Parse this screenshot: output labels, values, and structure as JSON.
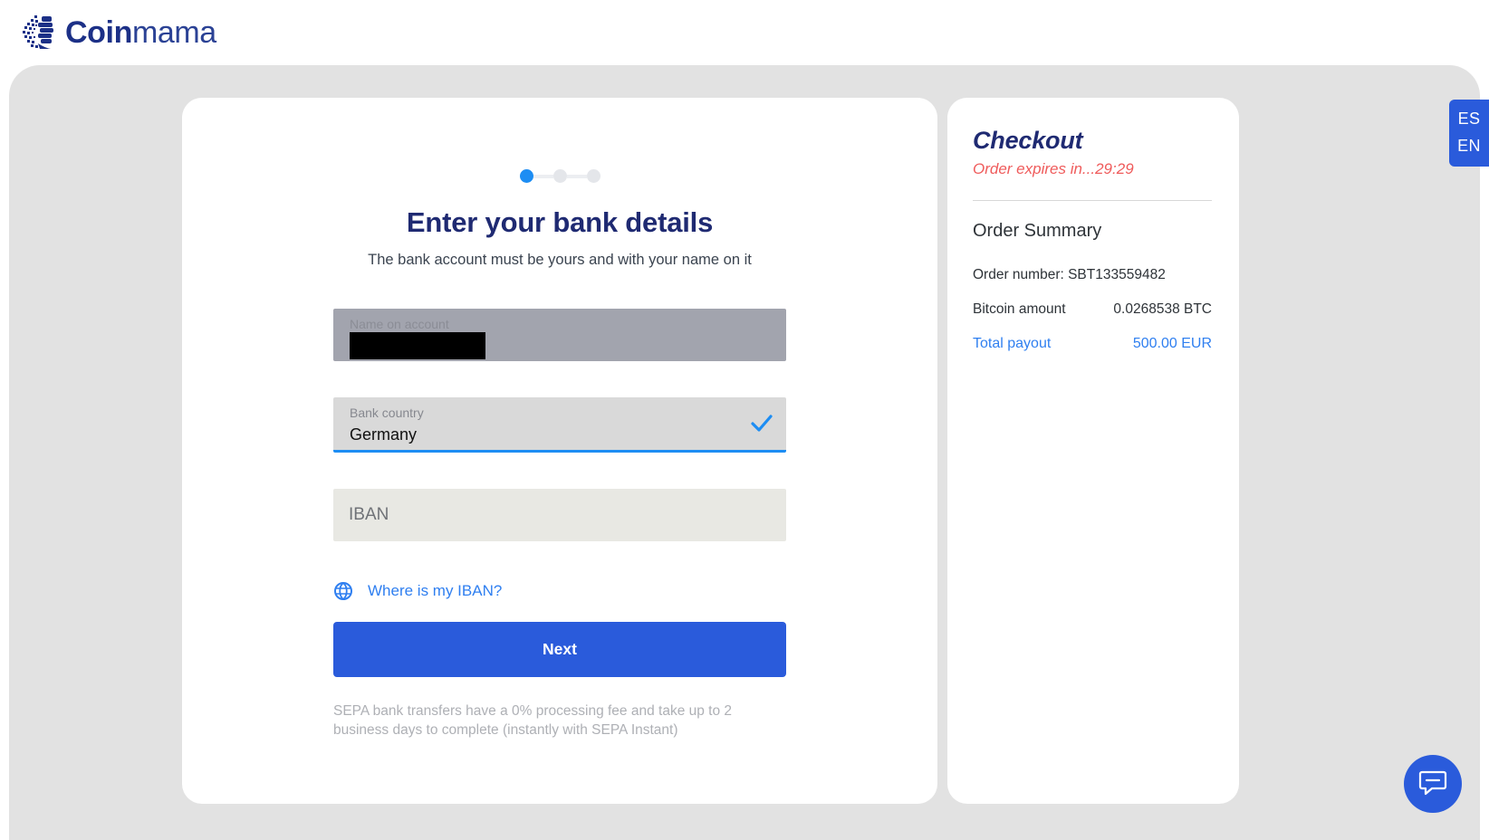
{
  "brand": {
    "name_bold": "Coin",
    "name_light": "mama",
    "logo_icon": "coinmama-logo-icon",
    "navy": "#1c3087",
    "accent_blue": "#2a5bdb",
    "link_blue": "#2f7ff0"
  },
  "language_switch": {
    "options": [
      "ES",
      "EN"
    ]
  },
  "steps": {
    "total": 3,
    "current": 1
  },
  "main": {
    "title": "Enter your bank details",
    "subtitle": "The bank account must be yours and with your name on it",
    "fields": [
      {
        "name": "name-on-account",
        "label": "Name on account",
        "value": "",
        "redacted": true,
        "state": "selected"
      },
      {
        "name": "bank-country",
        "label": "Bank country",
        "value": "Germany",
        "valid_icon": "check-icon",
        "state": "valid"
      },
      {
        "name": "iban",
        "label": "",
        "placeholder": "IBAN",
        "value": "",
        "state": "empty"
      }
    ],
    "iban_help": {
      "icon": "help-globe-icon",
      "label": "Where is my IBAN?"
    },
    "next_label": "Next",
    "fineprint": "SEPA bank transfers have a 0% processing fee and take up to 2 business days to complete (instantly with SEPA Instant)"
  },
  "checkout": {
    "title": "Checkout",
    "expires": "Order expires in...29:29",
    "summary_title": "Order Summary",
    "order_number": "Order number: SBT133559482",
    "rows": [
      {
        "label": "Bitcoin amount",
        "value": "0.0268538 BTC",
        "highlight": false
      },
      {
        "label": "Total payout",
        "value": "500.00 EUR",
        "highlight": true
      }
    ]
  },
  "chat": {
    "icon": "chat-bubble-icon"
  }
}
